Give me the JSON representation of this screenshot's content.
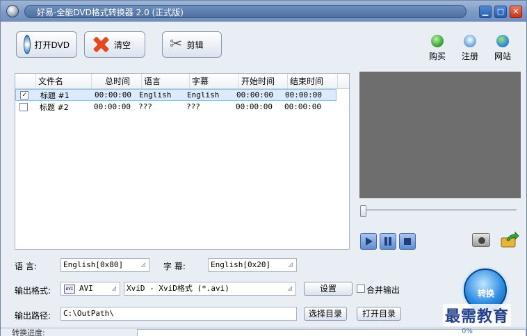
{
  "window": {
    "title": "好易-全能DVD格式转换器 2.0  (正式版)",
    "controls": [
      "minimize",
      "maximize",
      "close"
    ]
  },
  "toolbar": {
    "open_dvd": "打开DVD",
    "clear": "清空",
    "edit": "剪辑",
    "buy": "购买",
    "register": "注册",
    "website": "网站"
  },
  "list": {
    "columns": [
      "文件名",
      "总时间",
      "语言",
      "字幕",
      "开始时间",
      "结束时间"
    ],
    "rows": [
      {
        "checked": true,
        "name": "标题 #1",
        "total": "00:00:00",
        "lang": "English",
        "sub": "English",
        "start": "00:00:00",
        "end": "00:00:00"
      },
      {
        "checked": false,
        "name": "标题 #2",
        "total": "00:00:00",
        "lang": "???",
        "sub": "???",
        "start": "00:00:00",
        "end": "00:00:00"
      }
    ]
  },
  "form": {
    "lang_label": "语    言:",
    "lang_value": "English[0x80]",
    "sub_label": "字    幕:",
    "sub_value": "English[0x20]",
    "format_label": "输出格式:",
    "format_value": "AVI",
    "codec_value": "XviD - XviD格式 (*.avi)",
    "settings": "设置",
    "merge": "合并输出",
    "path_label": "输出路径:",
    "path_value": "C:\\OutPath\\",
    "choose_dir": "选择目录",
    "open_dir": "打开目录"
  },
  "convert": "转换",
  "watermark": "最需教育",
  "status": {
    "label": "转换进度:",
    "percent": "0%",
    "progress": 0
  },
  "colors": {
    "accent": "#2f8ee2",
    "preview": "#6e6e6e"
  }
}
